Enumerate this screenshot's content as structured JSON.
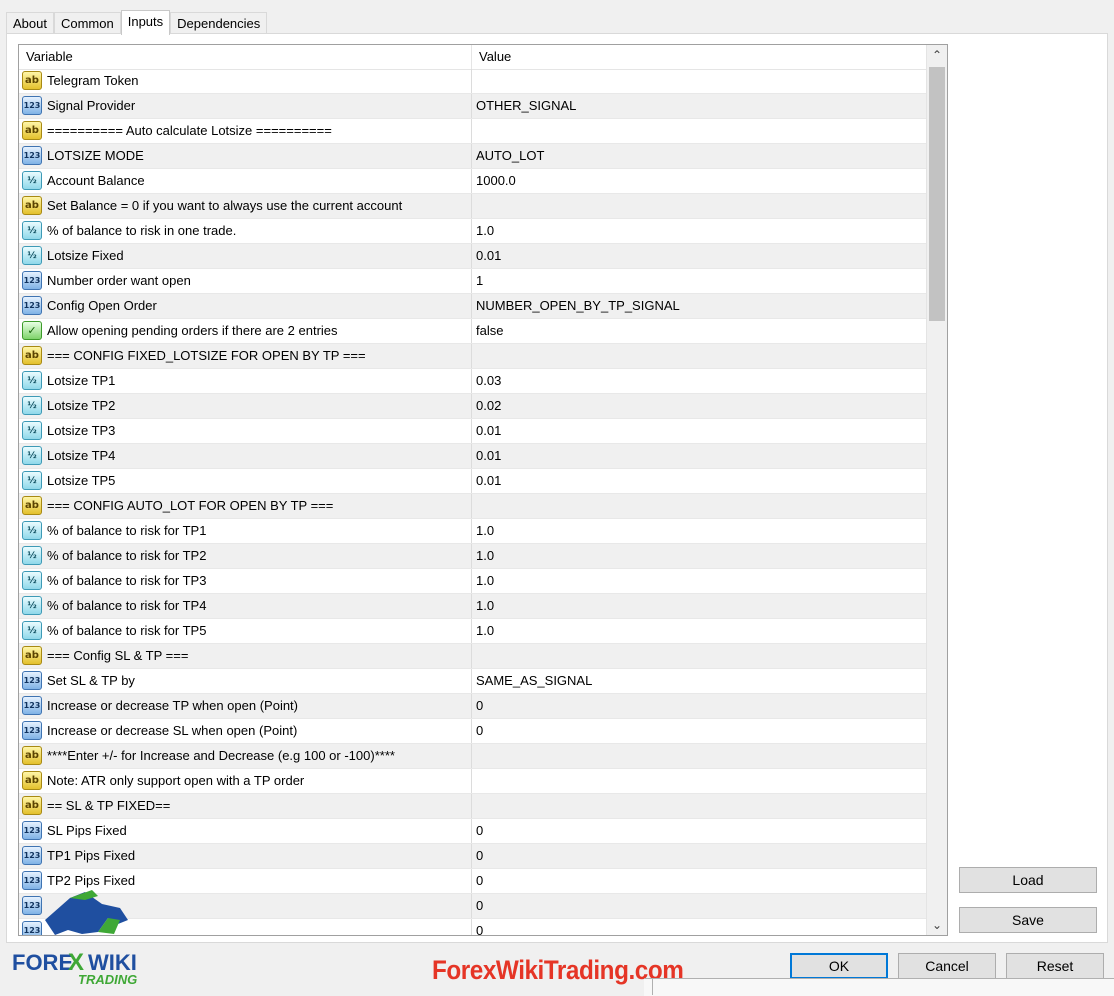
{
  "tabs": [
    "About",
    "Common",
    "Inputs",
    "Dependencies"
  ],
  "active_tab": "Inputs",
  "grid": {
    "header_variable": "Variable",
    "header_value": "Value",
    "rows": [
      {
        "icon": "ab",
        "name": "Telegram Token",
        "value": ""
      },
      {
        "icon": "123",
        "name": "Signal Provider",
        "value": "OTHER_SIGNAL"
      },
      {
        "icon": "ab",
        "name": "========== Auto calculate Lotsize ==========",
        "value": ""
      },
      {
        "icon": "123",
        "name": "LOTSIZE MODE",
        "value": "AUTO_LOT"
      },
      {
        "icon": "half",
        "name": "Account Balance",
        "value": "1000.0"
      },
      {
        "icon": "ab",
        "name": "Set Balance = 0 if you want to always use the current account",
        "value": ""
      },
      {
        "icon": "half",
        "name": "% of balance to risk in one trade.",
        "value": "1.0"
      },
      {
        "icon": "half",
        "name": "Lotsize Fixed",
        "value": "0.01"
      },
      {
        "icon": "123",
        "name": "Number order want open",
        "value": "1"
      },
      {
        "icon": "123",
        "name": "Config Open Order",
        "value": "NUMBER_OPEN_BY_TP_SIGNAL"
      },
      {
        "icon": "bool",
        "name": "Allow opening pending orders if there are 2 entries",
        "value": "false"
      },
      {
        "icon": "ab",
        "name": "=== CONFIG FIXED_LOTSIZE FOR OPEN BY TP ===",
        "value": ""
      },
      {
        "icon": "half",
        "name": "Lotsize TP1",
        "value": "0.03"
      },
      {
        "icon": "half",
        "name": "Lotsize TP2",
        "value": "0.02"
      },
      {
        "icon": "half",
        "name": "Lotsize TP3",
        "value": "0.01"
      },
      {
        "icon": "half",
        "name": "Lotsize TP4",
        "value": "0.01"
      },
      {
        "icon": "half",
        "name": "Lotsize TP5",
        "value": "0.01"
      },
      {
        "icon": "ab",
        "name": "=== CONFIG AUTO_LOT FOR OPEN BY TP ===",
        "value": ""
      },
      {
        "icon": "half",
        "name": "% of balance to risk for TP1",
        "value": "1.0"
      },
      {
        "icon": "half",
        "name": "% of balance to risk for TP2",
        "value": "1.0"
      },
      {
        "icon": "half",
        "name": "% of balance to risk for TP3",
        "value": "1.0"
      },
      {
        "icon": "half",
        "name": "% of balance to risk for TP4",
        "value": "1.0"
      },
      {
        "icon": "half",
        "name": "% of balance to risk for TP5",
        "value": "1.0"
      },
      {
        "icon": "ab",
        "name": "=== Config SL & TP ===",
        "value": ""
      },
      {
        "icon": "123",
        "name": "Set SL & TP by",
        "value": "SAME_AS_SIGNAL"
      },
      {
        "icon": "123",
        "name": "Increase or decrease TP when open (Point)",
        "value": "0"
      },
      {
        "icon": "123",
        "name": "Increase or decrease SL when open (Point)",
        "value": "0"
      },
      {
        "icon": "ab",
        "name": "****Enter +/- for Increase and Decrease (e.g 100 or -100)****",
        "value": ""
      },
      {
        "icon": "ab",
        "name": "Note: ATR only support open with a TP order",
        "value": ""
      },
      {
        "icon": "ab",
        "name": "== SL & TP FIXED==",
        "value": ""
      },
      {
        "icon": "123",
        "name": "SL Pips Fixed",
        "value": "0"
      },
      {
        "icon": "123",
        "name": "TP1 Pips Fixed",
        "value": "0"
      },
      {
        "icon": "123",
        "name": "TP2 Pips Fixed",
        "value": "0"
      },
      {
        "icon": "123",
        "name": "",
        "value": "0"
      },
      {
        "icon": "123",
        "name": "",
        "value": "0"
      }
    ]
  },
  "buttons": {
    "load": "Load",
    "save": "Save",
    "ok": "OK",
    "cancel": "Cancel",
    "reset": "Reset"
  },
  "logo": {
    "line1": "FOREX WIKI",
    "line2": "TRADING"
  },
  "watermark": "ForexWikiTrading.com",
  "colors": {
    "watermark": "#e53526",
    "logo_blue": "#1f4fa0",
    "logo_green": "#3fa836",
    "ok_border": "#0078d7"
  }
}
